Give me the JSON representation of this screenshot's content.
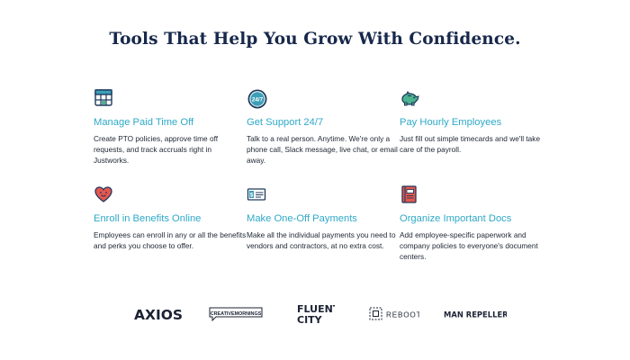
{
  "heading": "Tools That Help You Grow With Confidence.",
  "features": [
    {
      "title": "Manage Paid Time Off",
      "desc": "Create PTO policies, approve time off requests, and track accruals right in Justworks.",
      "icon": "calendar-icon"
    },
    {
      "title": "Get Support 24/7",
      "desc": "Talk to a real person. Anytime. We're only a phone call, Slack message, live chat, or email away.",
      "icon": "support-24-7-icon",
      "icon_text": "24/7"
    },
    {
      "title": "Pay Hourly Employees",
      "desc": "Just fill out simple timecards and we'll take care of the payroll.",
      "icon": "piggy-bank-icon"
    },
    {
      "title": "Enroll in Benefits Online",
      "desc": "Employees can enroll in any or all the benefits and perks you choose to offer.",
      "icon": "heart-icon"
    },
    {
      "title": "Make One-Off Payments",
      "desc": "Make all the individual payments you need to vendors and contractors, at no extra cost.",
      "icon": "check-payment-icon"
    },
    {
      "title": "Organize Important Docs",
      "desc": "Add employee-specific paperwork and company policies to everyone's document centers.",
      "icon": "document-book-icon"
    }
  ],
  "logos": [
    {
      "name": "axios-logo",
      "text": "AXIOS"
    },
    {
      "name": "creativemornings-logo",
      "text": "CREATIVEMORNINGS"
    },
    {
      "name": "fluent-city-logo",
      "text_line1": "FLUENT",
      "text_line2": "CITY"
    },
    {
      "name": "reboot-logo",
      "text": "REBOOT"
    },
    {
      "name": "man-repeller-logo",
      "text": "MAN REPELLER"
    }
  ],
  "colors": {
    "heading": "#17284b",
    "accent_title": "#2fa9c8",
    "body_text": "#222a36",
    "icon_teal": "#3b9fb8",
    "icon_green": "#4cb28f",
    "icon_red": "#e4574f",
    "icon_navy": "#1f3a5c"
  }
}
